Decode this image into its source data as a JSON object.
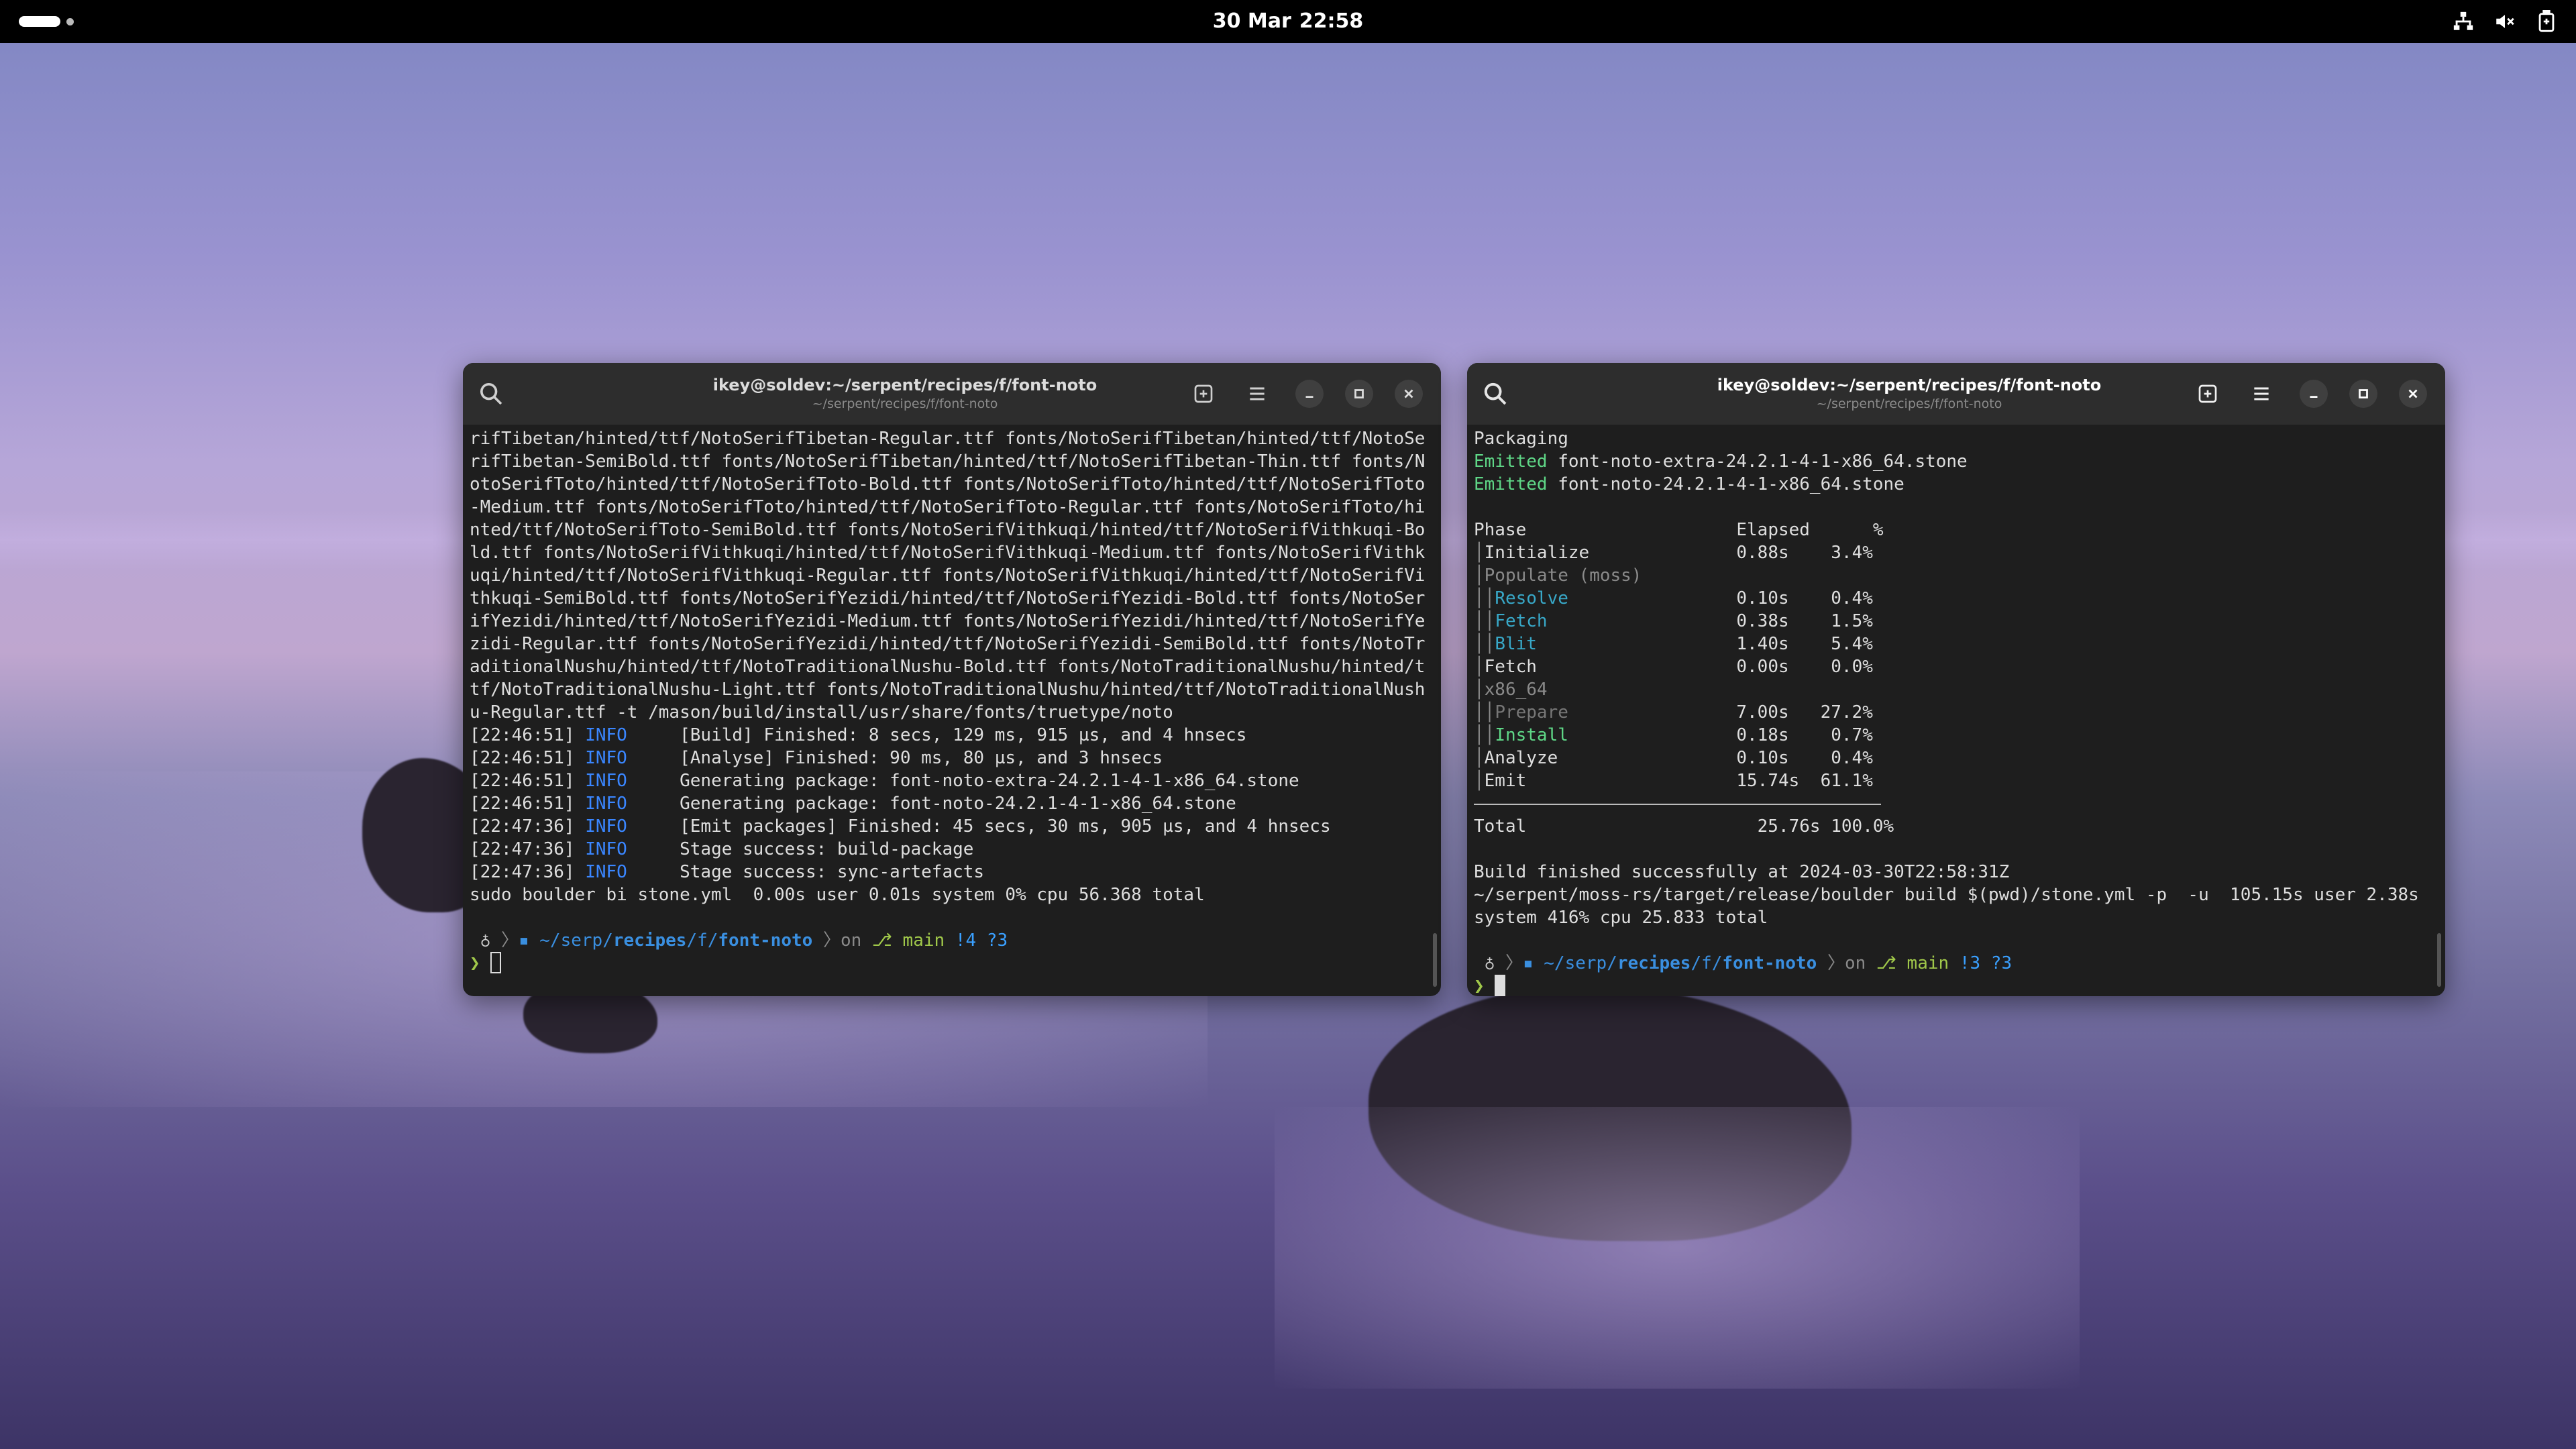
{
  "topbar": {
    "date": "30 Mar",
    "time": "22:58",
    "tray_icons": [
      "network-icon",
      "volume-muted-icon",
      "battery-icon"
    ]
  },
  "left_terminal": {
    "title": "ikey@soldev:~/serpent/recipes/f/font-noto",
    "subtitle": "~/serpent/recipes/f/font-noto",
    "wrapped_text": "rifTibetan/hinted/ttf/NotoSerifTibetan-Regular.ttf fonts/NotoSerifTibetan/hinted/ttf/NotoSerifTibetan-SemiBold.ttf fonts/NotoSerifTibetan/hinted/ttf/NotoSerifTibetan-Thin.ttf fonts/NotoSerifToto/hinted/ttf/NotoSerifToto-Bold.ttf fonts/NotoSerifToto/hinted/ttf/NotoSerifToto-Medium.ttf fonts/NotoSerifToto/hinted/ttf/NotoSerifToto-Regular.ttf fonts/NotoSerifToto/hinted/ttf/NotoSerifToto-SemiBold.ttf fonts/NotoSerifVithkuqi/hinted/ttf/NotoSerifVithkuqi-Bold.ttf fonts/NotoSerifVithkuqi/hinted/ttf/NotoSerifVithkuqi-Medium.ttf fonts/NotoSerifVithkuqi/hinted/ttf/NotoSerifVithkuqi-Regular.ttf fonts/NotoSerifVithkuqi/hinted/ttf/NotoSerifVithkuqi-SemiBold.ttf fonts/NotoSerifYezidi/hinted/ttf/NotoSerifYezidi-Bold.ttf fonts/NotoSerifYezidi/hinted/ttf/NotoSerifYezidi-Medium.ttf fonts/NotoSerifYezidi/hinted/ttf/NotoSerifYezidi-Regular.ttf fonts/NotoSerifYezidi/hinted/ttf/NotoSerifYezidi-SemiBold.ttf fonts/NotoTraditionalNushu/hinted/ttf/NotoTraditionalNushu-Bold.ttf fonts/NotoTraditionalNushu/hinted/ttf/NotoTraditionalNushu-Light.ttf fonts/NotoTraditionalNushu/hinted/ttf/NotoTraditionalNushu-Regular.ttf -t /mason/build/install/usr/share/fonts/truetype/noto",
    "log_lines": [
      {
        "time": "[22:46:51]",
        "level": "INFO",
        "msg": "[Build] Finished: 8 secs, 129 ms, 915 µs, and 4 hnsecs"
      },
      {
        "time": "[22:46:51]",
        "level": "INFO",
        "msg": "[Analyse] Finished: 90 ms, 80 µs, and 3 hnsecs"
      },
      {
        "time": "[22:46:51]",
        "level": "INFO",
        "msg": "Generating package: font-noto-extra-24.2.1-4-1-x86_64.stone"
      },
      {
        "time": "[22:46:51]",
        "level": "INFO",
        "msg": "Generating package: font-noto-24.2.1-4-1-x86_64.stone"
      },
      {
        "time": "[22:47:36]",
        "level": "INFO",
        "msg": "[Emit packages] Finished: 45 secs, 30 ms, 905 µs, and 4 hnsecs"
      },
      {
        "time": "[22:47:36]",
        "level": "INFO",
        "msg": "Stage success: build-package"
      },
      {
        "time": "[22:47:36]",
        "level": "INFO",
        "msg": "Stage success: sync-artefacts"
      }
    ],
    "summary": "sudo boulder bi stone.yml  0.00s user 0.01s system 0% cpu 56.368 total",
    "prompt": {
      "os": "♁",
      "path_prefix": "~/serp/",
      "path_bold1": "recipes",
      "path_mid": "/f/",
      "path_bold2": "font-noto",
      "on": "on",
      "branch": "main",
      "status": "!4 ?3"
    }
  },
  "right_terminal": {
    "title": "ikey@soldev:~/serpent/recipes/f/font-noto",
    "subtitle": "~/serpent/recipes/f/font-noto",
    "packaging": "Packaging",
    "emitted": [
      {
        "label": "Emitted",
        "file": "font-noto-extra-24.2.1-4-1-x86_64.stone"
      },
      {
        "label": "Emitted",
        "file": "font-noto-24.2.1-4-1-x86_64.stone"
      }
    ],
    "table_header": {
      "phase": "Phase",
      "elapsed": "Elapsed",
      "pct": "%"
    },
    "phases": [
      {
        "name": "Initialize",
        "elapsed": "0.88s",
        "pct": "3.4%",
        "style": "normal",
        "indent": 1
      },
      {
        "name": "Populate (moss)",
        "elapsed": "",
        "pct": "",
        "style": "dim",
        "indent": 1
      },
      {
        "name": "Resolve",
        "elapsed": "0.10s",
        "pct": "0.4%",
        "style": "teal",
        "indent": 2
      },
      {
        "name": "Fetch",
        "elapsed": "0.38s",
        "pct": "1.5%",
        "style": "teal",
        "indent": 2
      },
      {
        "name": "Blit",
        "elapsed": "1.40s",
        "pct": "5.4%",
        "style": "teal",
        "indent": 2
      },
      {
        "name": "Fetch",
        "elapsed": "0.00s",
        "pct": "0.0%",
        "style": "normal",
        "indent": 1
      },
      {
        "name": "x86_64",
        "elapsed": "",
        "pct": "",
        "style": "dim",
        "indent": 1
      },
      {
        "name": "Prepare",
        "elapsed": "7.00s",
        "pct": "27.2%",
        "style": "gray2",
        "indent": 2
      },
      {
        "name": "Install",
        "elapsed": "0.18s",
        "pct": "0.7%",
        "style": "green",
        "indent": 2
      },
      {
        "name": "Analyze",
        "elapsed": "0.10s",
        "pct": "0.4%",
        "style": "normal",
        "indent": 1
      },
      {
        "name": "Emit",
        "elapsed": "15.74s",
        "pct": "61.1%",
        "style": "normal",
        "indent": 1
      }
    ],
    "total": {
      "label": "Total",
      "elapsed": "25.76s",
      "pct": "100.0%"
    },
    "build_finished": "Build finished successfully at 2024-03-30T22:58:31Z",
    "command_summary": "~/serpent/moss-rs/target/release/boulder build $(pwd)/stone.yml -p  -u  105.15s user 2.38s system 416% cpu 25.833 total",
    "prompt": {
      "os": "♁",
      "path_prefix": "~/serp/",
      "path_bold1": "recipes",
      "path_mid": "/f/",
      "path_bold2": "font-noto",
      "on": "on",
      "branch": "main",
      "status": "!3 ?3"
    }
  }
}
